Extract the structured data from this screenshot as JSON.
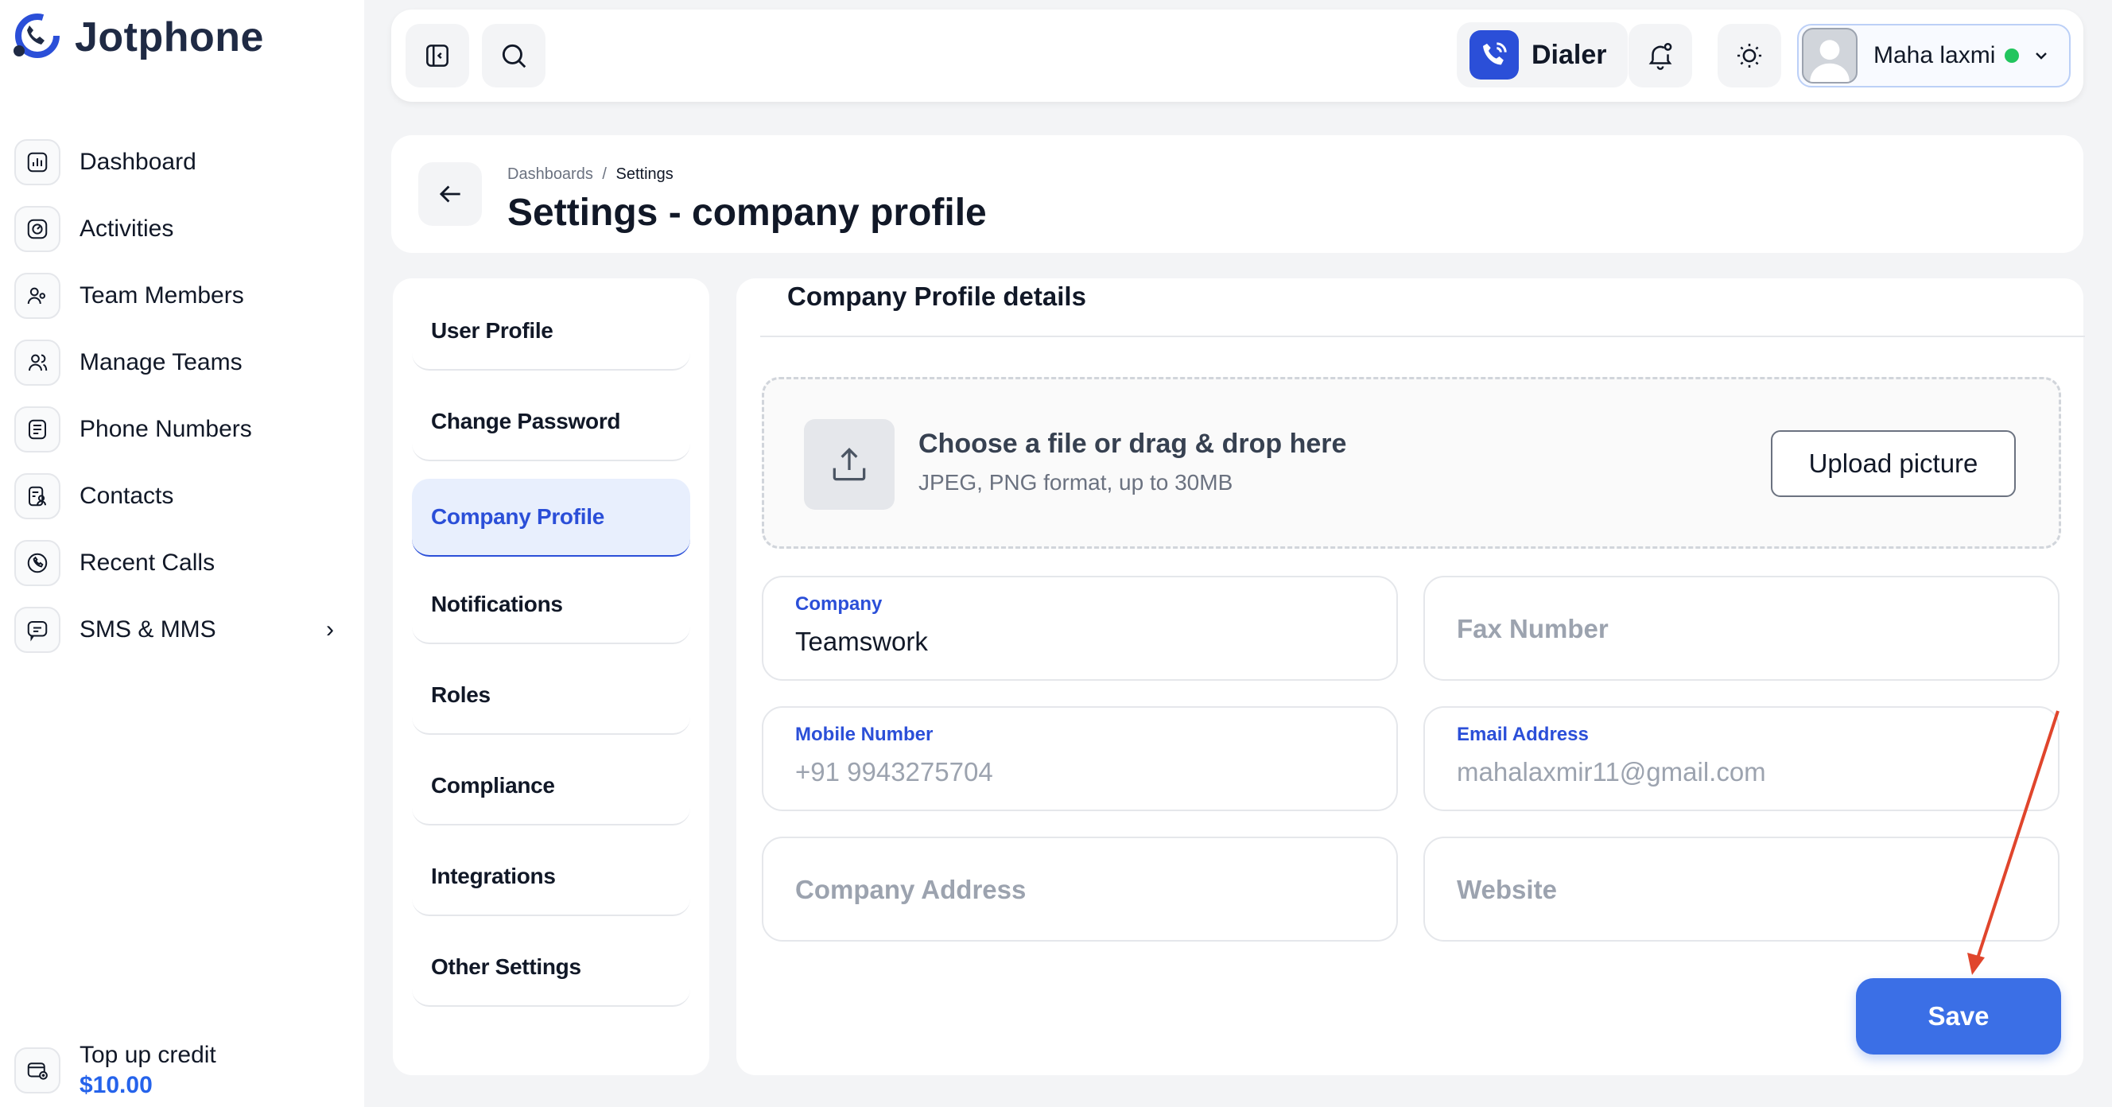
{
  "brand": {
    "name": "Jotphone",
    "accent": "#2b4fd8"
  },
  "sidebar": {
    "items": [
      {
        "label": "Dashboard",
        "icon": "dashboard-icon"
      },
      {
        "label": "Activities",
        "icon": "activities-icon"
      },
      {
        "label": "Team Members",
        "icon": "team-members-icon"
      },
      {
        "label": "Manage Teams",
        "icon": "manage-teams-icon"
      },
      {
        "label": "Phone Numbers",
        "icon": "phone-numbers-icon"
      },
      {
        "label": "Contacts",
        "icon": "contacts-icon"
      },
      {
        "label": "Recent Calls",
        "icon": "recent-calls-icon"
      },
      {
        "label": "SMS & MMS",
        "icon": "sms-icon",
        "chevron": "›"
      }
    ],
    "topup": {
      "label": "Top up credit",
      "amount": "$10.00"
    }
  },
  "topbar": {
    "dialer_label": "Dialer",
    "user_name": "Maha laxmi",
    "status_color": "#22c55e"
  },
  "header": {
    "breadcrumb": {
      "parent": "Dashboards",
      "separator": "/",
      "current": "Settings"
    },
    "title": "Settings - company profile"
  },
  "settings_menu": {
    "items": [
      {
        "label": "User Profile"
      },
      {
        "label": "Change Password"
      },
      {
        "label": "Company Profile",
        "active": true
      },
      {
        "label": "Notifications"
      },
      {
        "label": "Roles"
      },
      {
        "label": "Compliance"
      },
      {
        "label": "Integrations"
      },
      {
        "label": "Other Settings"
      }
    ]
  },
  "main": {
    "section_title": "Company Profile details",
    "upload": {
      "title": "Choose a file or drag & drop here",
      "subtitle": "JPEG, PNG format, up to 30MB",
      "button": "Upload picture"
    },
    "fields": {
      "company": {
        "label": "Company",
        "value": "Teamswork"
      },
      "fax": {
        "placeholder": "Fax Number"
      },
      "mobile": {
        "label": "Mobile Number",
        "value": "+91 9943275704"
      },
      "email": {
        "label": "Email Address",
        "value": "mahalaxmir11@gmail.com"
      },
      "address": {
        "placeholder": "Company Address"
      },
      "website": {
        "placeholder": "Website"
      }
    },
    "save_label": "Save"
  }
}
